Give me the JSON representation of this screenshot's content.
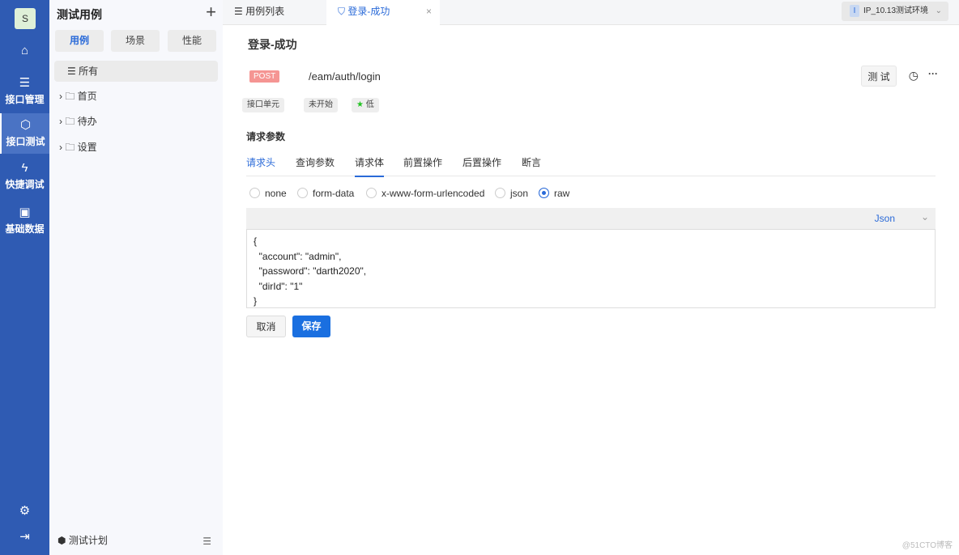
{
  "nav": {
    "avatar": "S",
    "items": [
      {
        "label": "接口管理"
      },
      {
        "label": "接口测试"
      },
      {
        "label": "快捷调试"
      },
      {
        "label": "基础数据"
      }
    ]
  },
  "tree": {
    "title": "测试用例",
    "segments": [
      "用例",
      "场景",
      "性能"
    ],
    "items": [
      "所有",
      "首页",
      "待办",
      "设置"
    ],
    "footer": "测试计划"
  },
  "tabs": {
    "list": "用例列表",
    "active": "登录-成功",
    "env": "IP_10.13测试环境",
    "env_badge": "I"
  },
  "case": {
    "title": "登录-成功",
    "method": "POST",
    "url": "/eam/auth/login",
    "test_button": "测 试",
    "tags": [
      "接口单元",
      "未开始",
      "低"
    ]
  },
  "params": {
    "heading": "请求参数",
    "tabs": [
      "请求头",
      "查询参数",
      "请求体",
      "前置操作",
      "后置操作",
      "断言"
    ],
    "radios": [
      "none",
      "form-data",
      "x-www-form-urlencoded",
      "json",
      "raw"
    ],
    "selected": "raw",
    "format": "Json",
    "body": "{\n  \"account\": \"admin\",\n  \"password\": \"darth2020\",\n  \"dirId\": \"1\"\n}",
    "cancel": "取消",
    "save": "保存"
  },
  "watermark": "@51CTO博客"
}
